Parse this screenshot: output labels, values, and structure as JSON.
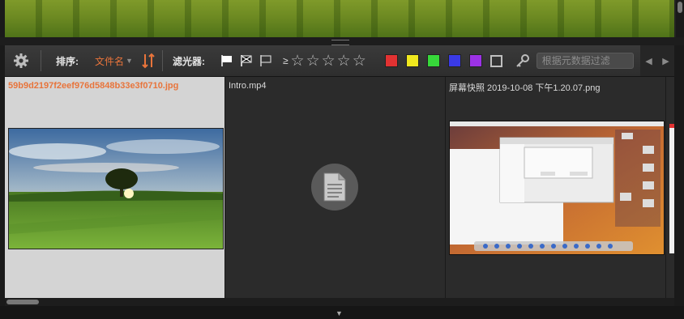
{
  "toolbar": {
    "sort_label": "排序:",
    "sort_value": "文件名",
    "filter_label": "滤光器:",
    "rating_ge": "≥",
    "stars": [
      "☆",
      "☆",
      "☆",
      "☆",
      "☆"
    ],
    "colors": [
      "#e23232",
      "#f0e81e",
      "#37d83a",
      "#3a3ae6",
      "#9c32e6"
    ],
    "search_placeholder": "根据元数据过滤"
  },
  "files": [
    {
      "name": "59b9d2197f2eef976d5848b33e3f0710.jpg",
      "selected": true,
      "type": "image"
    },
    {
      "name": "Intro.mp4",
      "selected": false,
      "type": "video"
    },
    {
      "name": "屏幕快照 2019-10-08 下午1.20.07.png",
      "selected": false,
      "type": "image"
    }
  ]
}
